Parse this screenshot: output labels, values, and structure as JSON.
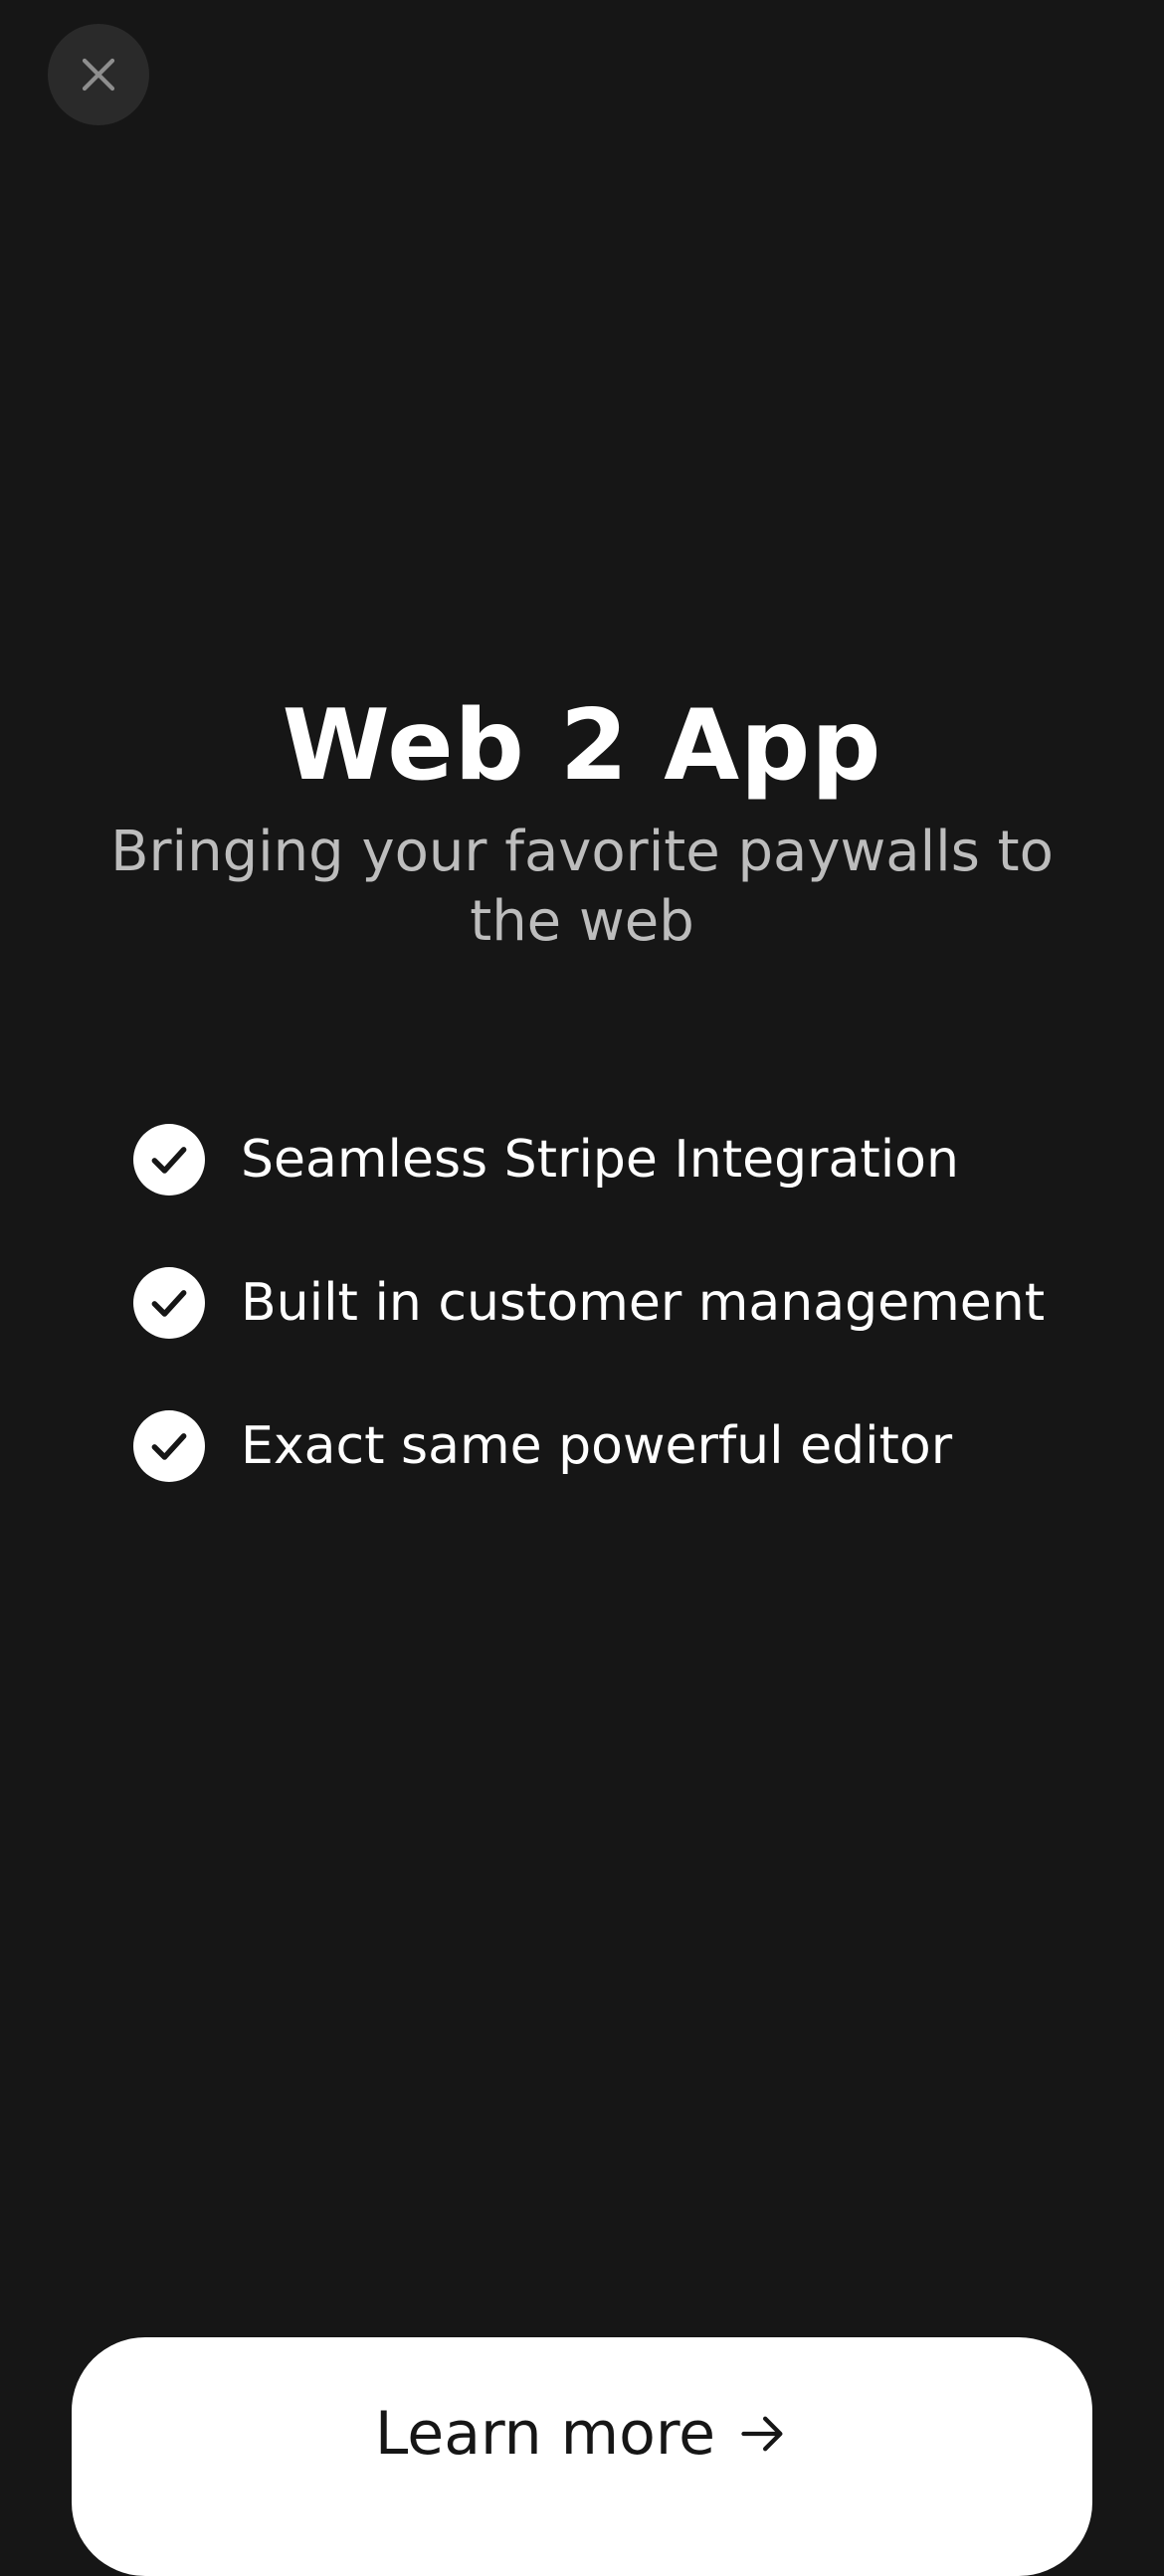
{
  "header": {
    "close_icon": "close-icon"
  },
  "hero": {
    "title": "Web 2 App",
    "subtitle": "Bringing your favorite paywalls to the web"
  },
  "features": [
    {
      "icon": "checkmark-circle-icon",
      "label": "Seamless Stripe Integration"
    },
    {
      "icon": "checkmark-circle-icon",
      "label": "Built in customer management"
    },
    {
      "icon": "checkmark-circle-icon",
      "label": "Exact same powerful editor"
    }
  ],
  "cta": {
    "label": "Learn more",
    "icon": "arrow-right-icon"
  },
  "colors": {
    "background": "#161616",
    "close_button_bg": "#2a2a2a",
    "subtitle": "#bdbdbd",
    "button_bg": "#ffffff",
    "button_text": "#161616"
  }
}
